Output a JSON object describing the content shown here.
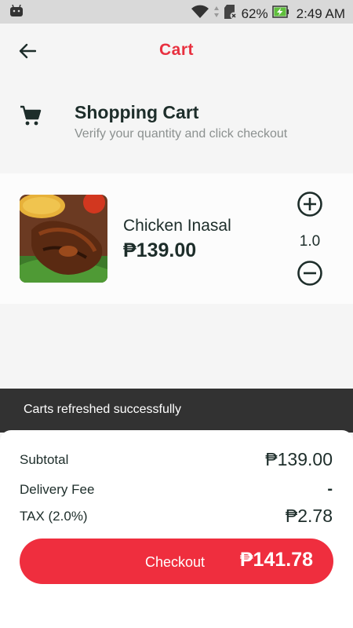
{
  "status_bar": {
    "battery_percent": "62%",
    "time": "2:49 AM",
    "icons": [
      "android-icon",
      "wifi-icon",
      "sd-card-icon",
      "battery-charging-icon"
    ]
  },
  "app_bar": {
    "title": "Cart",
    "back_icon": "arrow-left-icon"
  },
  "section": {
    "title": "Shopping Cart",
    "subtitle": "Verify your quantity and click checkout",
    "icon": "shopping-cart-icon"
  },
  "cart_items": [
    {
      "name": "Chicken Inasal",
      "price": "₱139.00",
      "quantity": "1.0"
    }
  ],
  "snackbar": {
    "message": "Carts refreshed successfully"
  },
  "summary": {
    "subtotal_label": "Subtotal",
    "subtotal_value": "₱139.00",
    "delivery_label": "Delivery Fee",
    "delivery_value": "-",
    "tax_label": "TAX (2.0%)",
    "tax_value": "₱2.78"
  },
  "checkout": {
    "label": "Checkout",
    "total": "₱141.78"
  },
  "colors": {
    "accent": "#e8303f",
    "button": "#ef2e3e",
    "snackbar": "#323232",
    "text": "#1d2d2a"
  }
}
